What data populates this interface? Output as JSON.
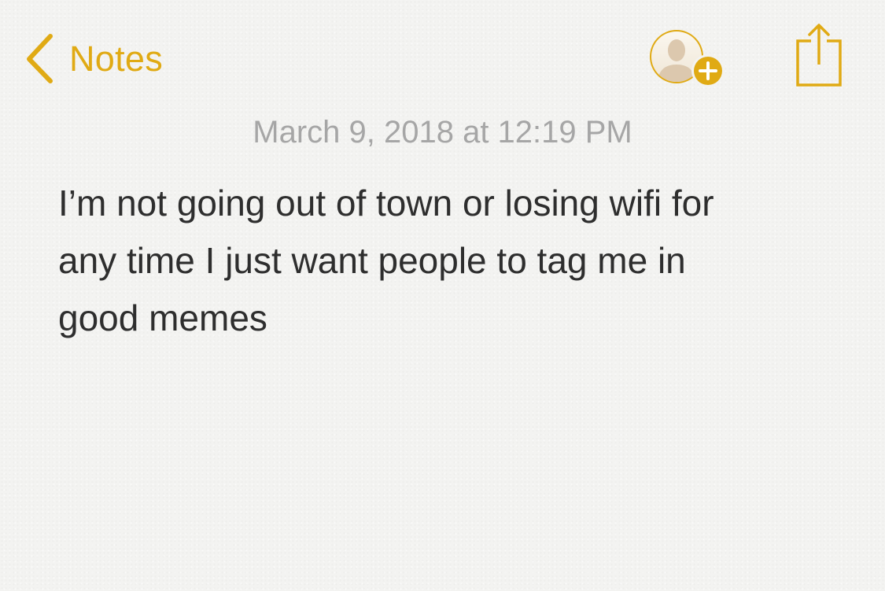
{
  "nav": {
    "back_label": "Notes",
    "back_icon": "chevron-left-icon",
    "add_people_icon": "add-person-icon",
    "share_icon": "share-icon"
  },
  "note": {
    "date": "March 9, 2018 at 12:19 PM",
    "body_lines": [
      "I’m not going out of town or losing wifi for",
      "any time I just want people to tag me in",
      "good memes"
    ]
  },
  "colors": {
    "accent": "#e0aa14",
    "date_text": "#a6a6a6",
    "body_text": "#2e2e2e"
  }
}
